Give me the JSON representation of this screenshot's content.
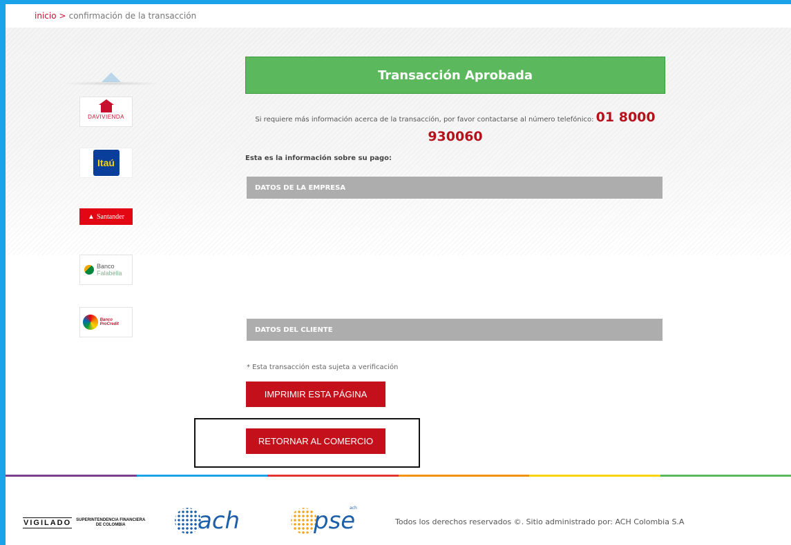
{
  "breadcrumb": {
    "home": "inicio",
    "separator": ">",
    "current": "confirmación de la transacción"
  },
  "banks": {
    "davivienda": "DAVIVIENDA",
    "itau": "Itaú",
    "santander": "Santander",
    "falabella_line1": "Banco",
    "falabella_line2": "Falabella",
    "procredit": "Banco ProCredit"
  },
  "status": {
    "title": "Transacción Aprobada",
    "info_text": "Si requiere más información acerca de la transacción, por favor contactarse al número telefónico:",
    "phone": "01 8000 930060",
    "payment_info": "Esta es la información sobre su pago:"
  },
  "sections": {
    "empresa": "DATOS DE LA EMPRESA",
    "cliente": "DATOS DEL CLIENTE"
  },
  "note": "* Esta transacción esta sujeta a verificación",
  "buttons": {
    "print": "IMPRIMIR ESTA PÁGINA",
    "return": "RETORNAR AL COMERCIO"
  },
  "footer": {
    "vigilado": "VIGILADO",
    "superintendencia_line1": "SUPERINTENDENCIA FINANCIERA",
    "superintendencia_line2": "DE COLOMBIA",
    "ach": "ach",
    "pse_small": "ach",
    "pse": "pse",
    "copyright": "Todos los derechos reservados ©. Sitio administrado por: ACH Colombia S.A"
  },
  "colors": {
    "frame": "#1aa3e8",
    "approved": "#5cb85c",
    "button": "#c4101a",
    "phone": "#b5121b",
    "rule": [
      "#7a3c8c",
      "#1aa3e8",
      "#e3342f",
      "#f39200",
      "#ffd400",
      "#5cb85c"
    ]
  }
}
